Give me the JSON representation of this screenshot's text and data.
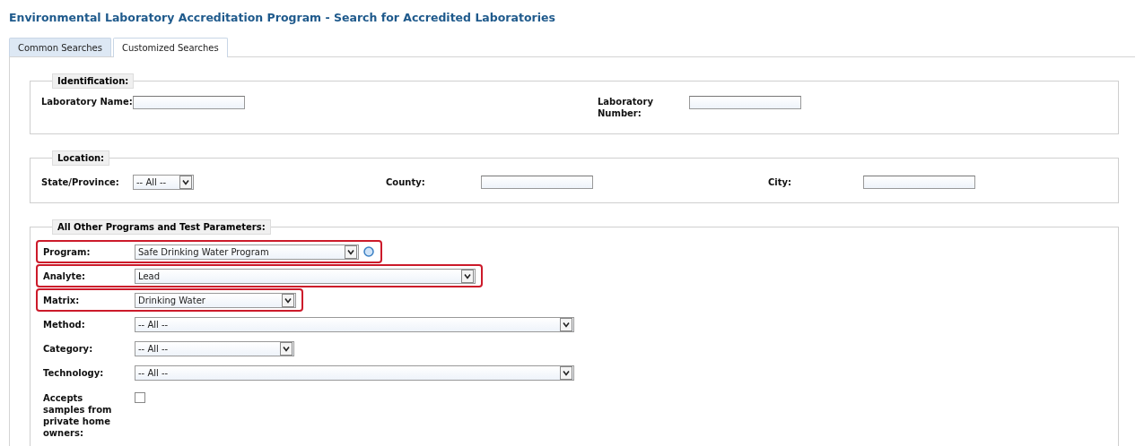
{
  "page_title": "Environmental Laboratory Accreditation Program - Search for Accredited Laboratories",
  "tabs": [
    {
      "label": "Common Searches",
      "selected": false
    },
    {
      "label": "Customized Searches",
      "selected": true
    }
  ],
  "identification": {
    "legend": "Identification:",
    "fields": [
      {
        "label": "Laboratory Name:"
      },
      {
        "label": "Laboratory Number:"
      }
    ]
  },
  "location": {
    "legend": "Location:",
    "fields": [
      {
        "label": "State/Province:",
        "kind": "select",
        "value": "-- All --"
      },
      {
        "label": "County:",
        "kind": "text"
      },
      {
        "label": "City:",
        "kind": "text"
      }
    ]
  },
  "parameters": {
    "legend": "All Other Programs and Test Parameters:",
    "rows": [
      {
        "label": "Program:",
        "kind": "select",
        "value": "Safe Drinking Water Program",
        "highlighted": true
      },
      {
        "label": "Analyte:",
        "kind": "select",
        "value": "Lead",
        "highlighted": true
      },
      {
        "label": "Matrix:",
        "kind": "select",
        "value": "Drinking Water",
        "highlighted": true
      },
      {
        "label": "Method:",
        "kind": "select",
        "value": "-- All --",
        "highlighted": false
      },
      {
        "label": "Category:",
        "kind": "select",
        "value": "-- All --",
        "highlighted": false
      },
      {
        "label": "Technology:",
        "kind": "select",
        "value": "-- All --",
        "highlighted": false
      },
      {
        "label": "Accepts samples from private home owners:",
        "kind": "checkbox",
        "checked": false,
        "highlighted": false
      }
    ]
  }
}
